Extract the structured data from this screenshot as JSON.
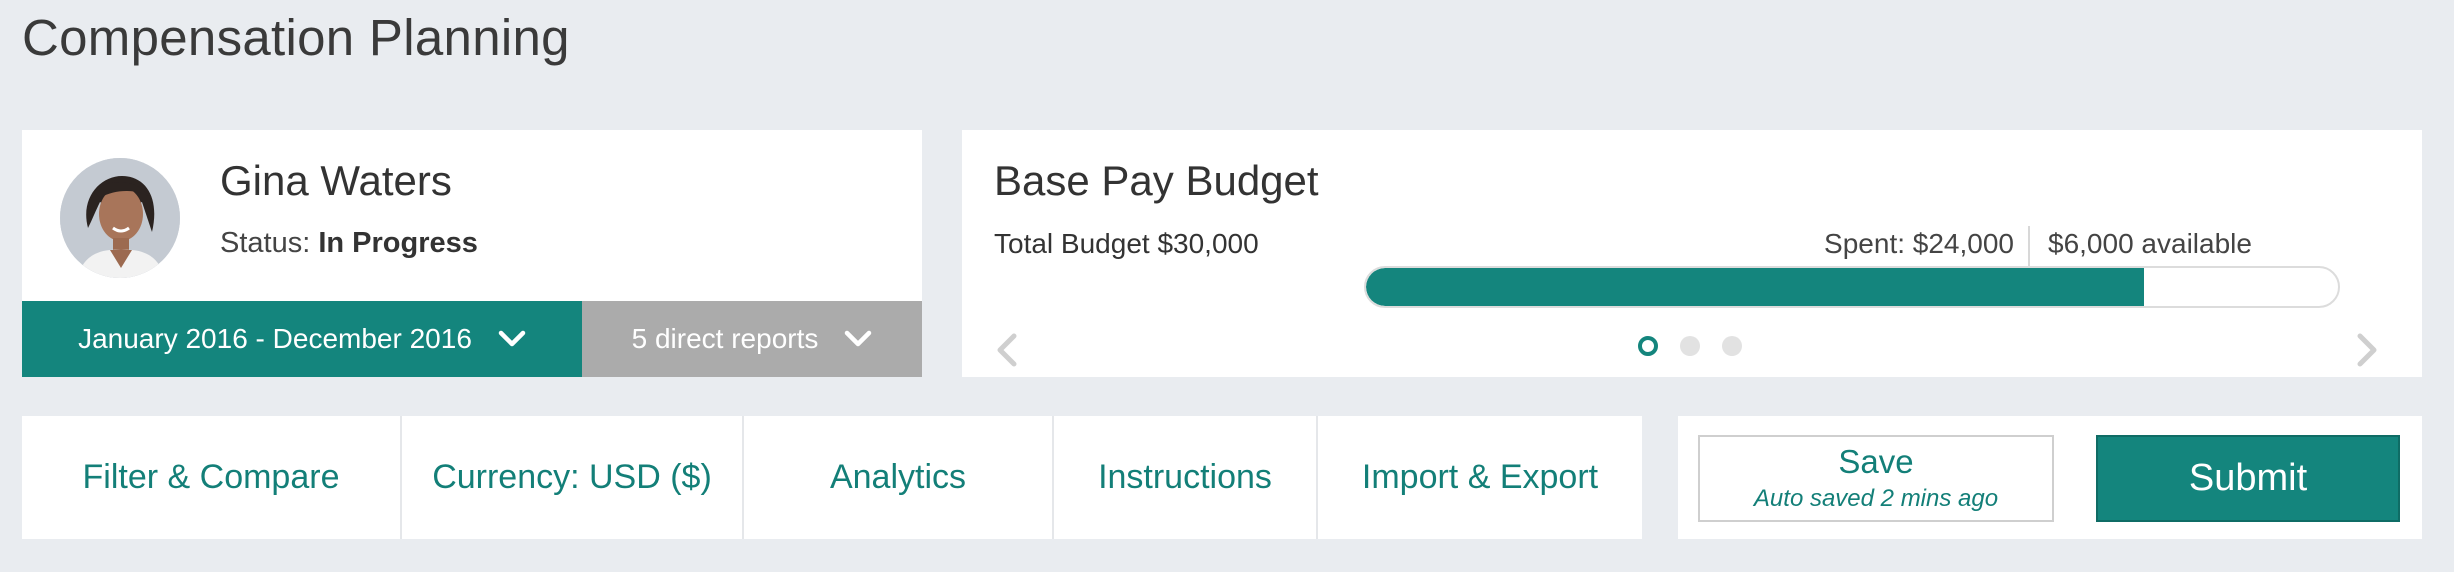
{
  "page": {
    "title": "Compensation Planning"
  },
  "employee": {
    "name": "Gina Waters",
    "status_label": "Status:",
    "status_value": "In Progress",
    "avatar_icon": "person-photo",
    "period": "January 2016 - December 2016",
    "reports": "5 direct reports"
  },
  "budget": {
    "title": "Base Pay Budget",
    "total": "Total Budget $30,000",
    "spent": "Spent: $24,000",
    "available": "$6,000 available",
    "spent_fraction": 0.8,
    "carousel": {
      "pages": 3,
      "active": 0
    }
  },
  "toolbar": {
    "items": [
      {
        "label": "Filter & Compare"
      },
      {
        "label": "Currency: USD ($)"
      },
      {
        "label": "Analytics"
      },
      {
        "label": "Instructions"
      },
      {
        "label": "Import & Export"
      }
    ]
  },
  "actions": {
    "save": "Save",
    "autosave": "Auto saved 2 mins ago",
    "submit": "Submit"
  },
  "colors": {
    "accent": "#14857d",
    "muted": "#ababab",
    "background": "#e9ecf0"
  }
}
